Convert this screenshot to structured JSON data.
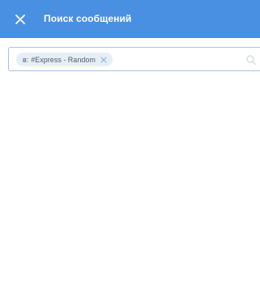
{
  "header": {
    "title": "Поиск сообщений",
    "close_icon": "close-icon",
    "background": "#4a90e2"
  },
  "search": {
    "chip": {
      "prefix": "в:",
      "channel": "#Express - Random",
      "remove_icon": "close-icon"
    },
    "value": "",
    "placeholder": "",
    "search_icon": "search-icon"
  },
  "results": {
    "items": []
  }
}
